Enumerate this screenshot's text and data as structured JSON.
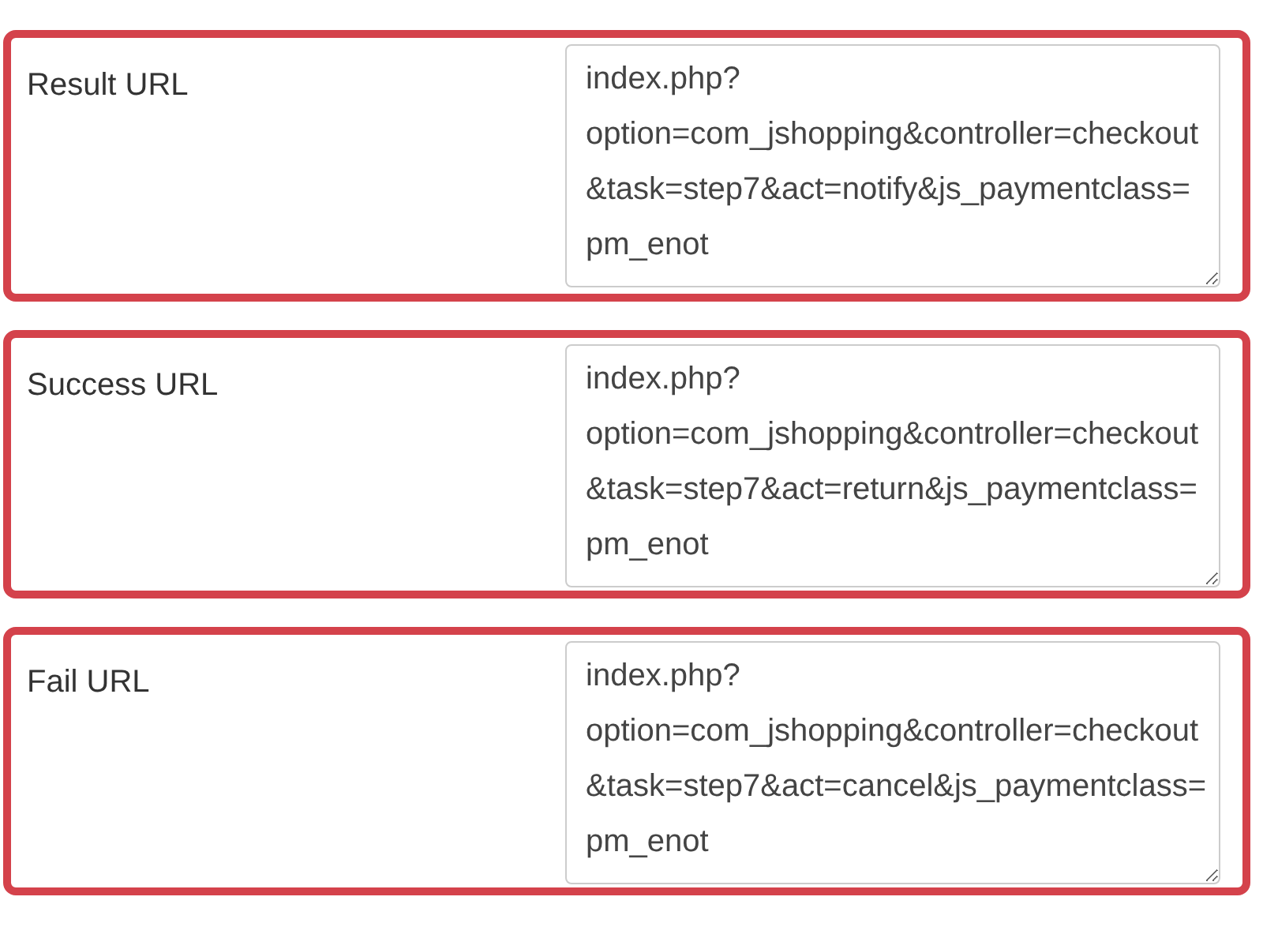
{
  "fields": [
    {
      "label": "Result URL",
      "value": "index.php?option=com_jshopping&controller=checkout&task=step7&act=notify&js_paymentclass=pm_enot"
    },
    {
      "label": "Success URL",
      "value": "index.php?option=com_jshopping&controller=checkout&task=step7&act=return&js_paymentclass=pm_enot"
    },
    {
      "label": "Fail URL",
      "value": "index.php?option=com_jshopping&controller=checkout&task=step7&act=cancel&js_paymentclass=pm_enot"
    }
  ]
}
